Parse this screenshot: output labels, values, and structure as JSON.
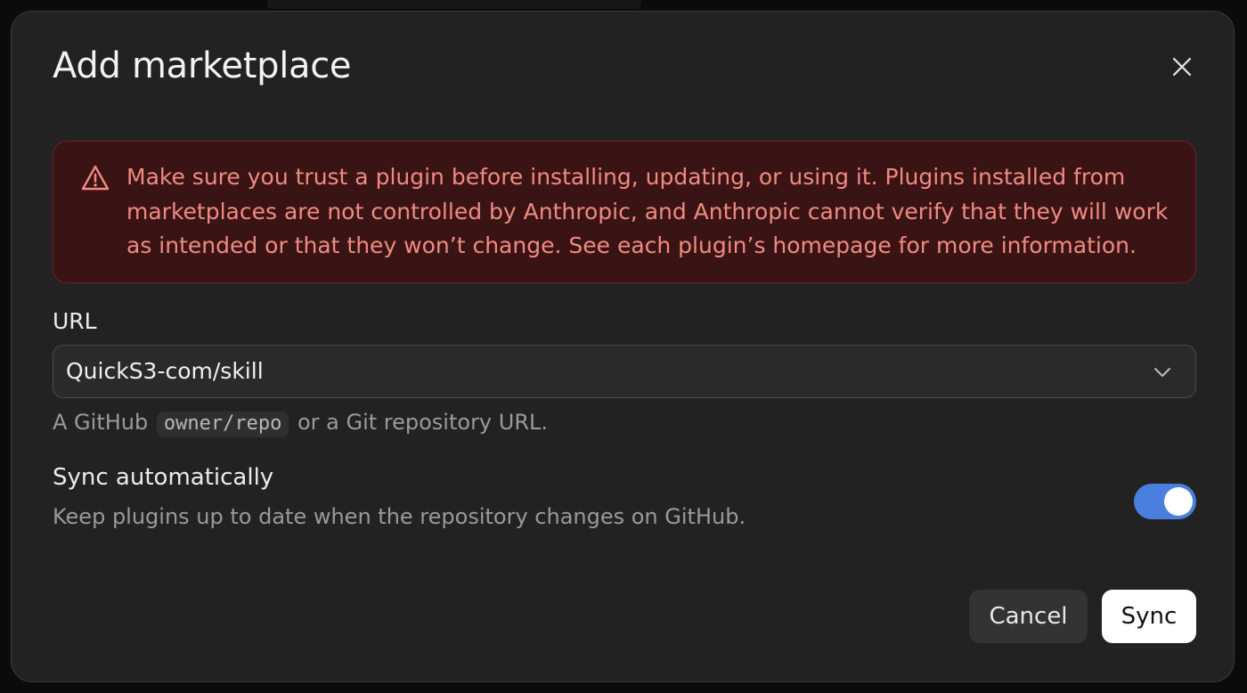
{
  "dialog": {
    "title": "Add marketplace",
    "close_icon": "close-icon"
  },
  "warning": {
    "icon": "warning-triangle-icon",
    "text": "Make sure you trust a plugin before installing, updating, or using it. Plugins installed from marketplaces are not controlled by Anthropic, and Anthropic cannot verify that they will work as intended or that they won’t change. See each plugin’s homepage for more information.",
    "text_color": "#f08a82",
    "background_color": "#3a1414"
  },
  "url_field": {
    "label": "URL",
    "value": "QuickS3-com/skill",
    "dropdown_icon": "chevron-down-icon",
    "helper_prefix": "A GitHub",
    "helper_code": "owner/repo",
    "helper_suffix": "or a Git repository URL."
  },
  "sync": {
    "title": "Sync automatically",
    "description": "Keep plugins up to date when the repository changes on GitHub.",
    "enabled": true,
    "toggle_color": "#4a7fe0"
  },
  "actions": {
    "cancel_label": "Cancel",
    "sync_label": "Sync"
  }
}
